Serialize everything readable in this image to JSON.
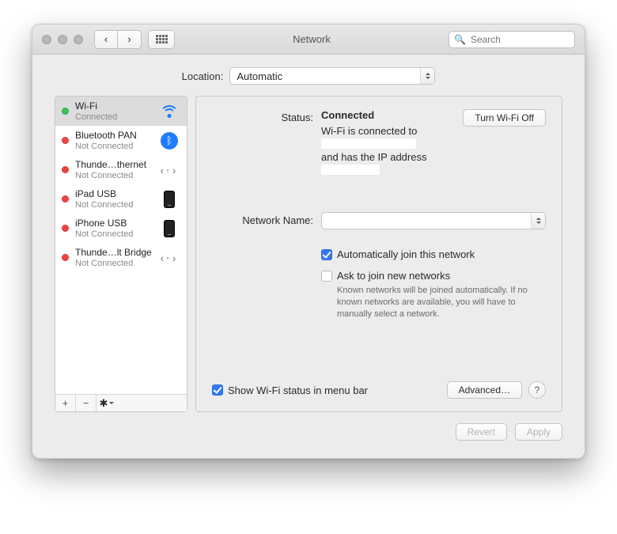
{
  "window": {
    "title": "Network",
    "search_placeholder": "Search"
  },
  "location": {
    "label": "Location:",
    "value": "Automatic"
  },
  "services": [
    {
      "name": "Wi-Fi",
      "status": "Connected",
      "dot": "green",
      "icon": "wifi",
      "selected": true
    },
    {
      "name": "Bluetooth PAN",
      "status": "Not Connected",
      "dot": "red",
      "icon": "bluetooth",
      "selected": false
    },
    {
      "name": "Thunde…thernet",
      "status": "Not Connected",
      "dot": "red",
      "icon": "thunderbolt",
      "selected": false
    },
    {
      "name": "iPad USB",
      "status": "Not Connected",
      "dot": "red",
      "icon": "phone",
      "selected": false
    },
    {
      "name": "iPhone USB",
      "status": "Not Connected",
      "dot": "red",
      "icon": "phone",
      "selected": false
    },
    {
      "name": "Thunde…lt Bridge",
      "status": "Not Connected",
      "dot": "red",
      "icon": "thunderbolt",
      "selected": false
    }
  ],
  "sidebar_actions": {
    "add": "+",
    "remove": "−",
    "gear": "✱"
  },
  "detail": {
    "status_label": "Status:",
    "status_value": "Connected",
    "wifi_toggle": "Turn Wi-Fi Off",
    "info_line1": "Wi-Fi is connected to ",
    "info_line2": "and has the IP address ",
    "network_name_label": "Network Name:",
    "network_name_value": "",
    "auto_join_label": "Automatically join this network",
    "auto_join_checked": true,
    "ask_join_label": "Ask to join new networks",
    "ask_join_checked": false,
    "ask_join_hint": "Known networks will be joined automatically. If no known networks are available, you will have to manually select a network.",
    "show_status_label": "Show Wi-Fi status in menu bar",
    "show_status_checked": true,
    "advanced_label": "Advanced…",
    "help": "?"
  },
  "footer": {
    "revert": "Revert",
    "apply": "Apply"
  }
}
